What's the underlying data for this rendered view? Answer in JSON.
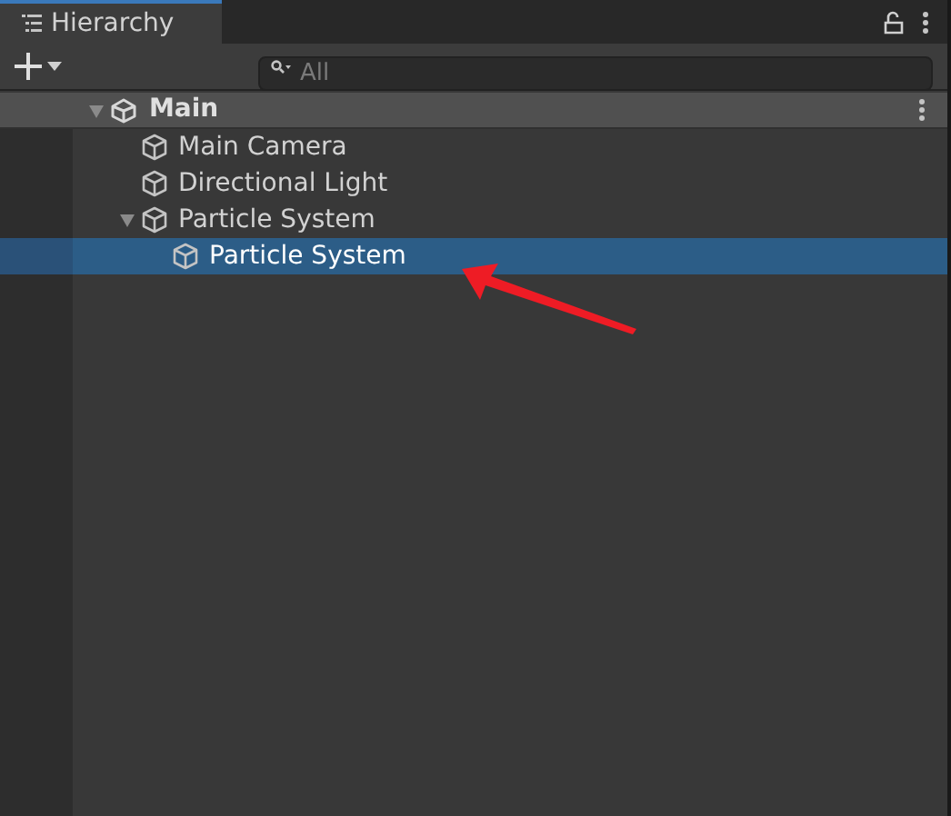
{
  "tab": {
    "title": "Hierarchy",
    "selected": true
  },
  "search": {
    "placeholder": "All"
  },
  "scene": {
    "name": "Main",
    "expanded": true,
    "children": [
      {
        "name": "Main Camera",
        "selected": false
      },
      {
        "name": "Directional Light",
        "selected": false
      },
      {
        "name": "Particle System",
        "selected": false,
        "expanded": true,
        "children": [
          {
            "name": "Particle System",
            "selected": true
          }
        ]
      }
    ]
  },
  "annotation": {
    "kind": "arrow"
  }
}
